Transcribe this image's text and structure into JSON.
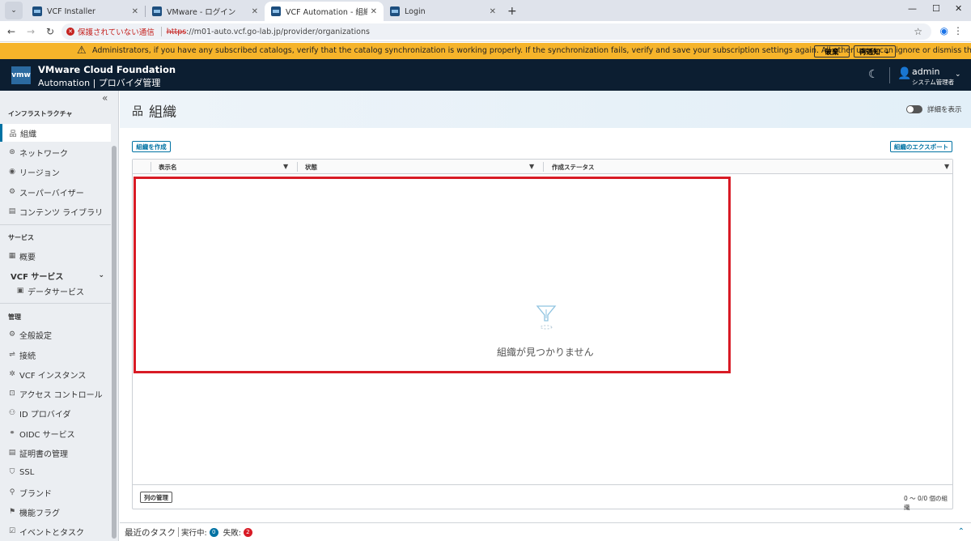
{
  "browser": {
    "tabs": [
      {
        "label": "VCF Installer",
        "active": false
      },
      {
        "label": "VMware - ログイン",
        "active": false
      },
      {
        "label": "VCF Automation - 組織",
        "active": true
      },
      {
        "label": "Login",
        "active": false
      }
    ],
    "security_label": "保護されていない通信",
    "url_scheme": "https",
    "url_rest": "://m01-auto.vcf.go-lab.jp/provider/organizations"
  },
  "banner": {
    "message": "Administrators, if you have any subscribed catalogs, verify that the catalog synchronization is working properly. If the synchronization fails, verify and save your subscription settings again. All other users can ignore or dismiss this message.",
    "dismiss_label": "破棄",
    "remind_label": "再通知",
    "color": "#f6b42a"
  },
  "header": {
    "logo": "vmw",
    "product": "VMware Cloud Foundation",
    "subtitle": "Automation | プロバイダ管理",
    "user_name": "admin",
    "user_role": "システム管理者"
  },
  "sidebar": {
    "sections": [
      {
        "title": "インフラストラクチャ"
      },
      {
        "title": "サービス"
      },
      {
        "title": "管理"
      }
    ],
    "items": [
      {
        "label": "組織",
        "icon": "org-icon"
      },
      {
        "label": "ネットワーク",
        "icon": "network-icon"
      },
      {
        "label": "リージョン",
        "icon": "region-icon"
      },
      {
        "label": "スーパーバイザー",
        "icon": "supervisor-icon"
      },
      {
        "label": "コンテンツ ライブラリ",
        "icon": "library-icon"
      },
      {
        "label": "概要",
        "icon": "overview-icon"
      },
      {
        "label": "VCF サービス",
        "icon": "vcf-services-icon"
      },
      {
        "label": "データサービス",
        "icon": "data-service-icon"
      },
      {
        "label": "全般設定",
        "icon": "settings-icon"
      },
      {
        "label": "接続",
        "icon": "connection-icon"
      },
      {
        "label": "VCF インスタンス",
        "icon": "vcf-instance-icon"
      },
      {
        "label": "アクセス コントロール",
        "icon": "access-control-icon"
      },
      {
        "label": "ID プロバイダ",
        "icon": "id-provider-icon"
      },
      {
        "label": "OIDC サービス",
        "icon": "oidc-icon"
      },
      {
        "label": "証明書の管理",
        "icon": "certificate-icon"
      },
      {
        "label": "SSL",
        "icon": "ssl-icon"
      },
      {
        "label": "ブランド",
        "icon": "brand-icon"
      },
      {
        "label": "機能フラグ",
        "icon": "flag-icon"
      },
      {
        "label": "イベントとタスク",
        "icon": "events-icon"
      }
    ]
  },
  "main": {
    "title": "組織",
    "toggle_label": "詳細を表示",
    "create_button": "組織を作成",
    "export_button": "組織のエクスポート",
    "columns": [
      "表示名",
      "状態",
      "作成ステータス"
    ],
    "empty_text": "組織が見つかりません",
    "manage_columns": "列の管理",
    "count_text": "0 ～ 0/0 個の組織"
  },
  "taskbar": {
    "title": "最近のタスク",
    "running_label": "実行中:",
    "running_count": "0",
    "failed_label": "失敗:",
    "failed_count": "2",
    "running_color": "#0072a3",
    "failed_color": "#d81b25"
  }
}
